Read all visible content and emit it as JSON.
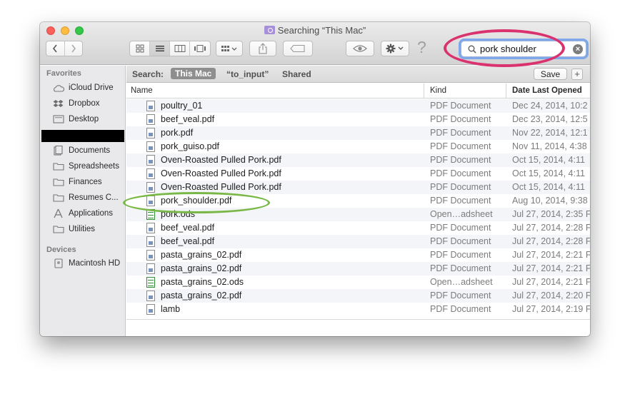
{
  "window": {
    "title": "Searching “This Mac”"
  },
  "toolbar": {
    "back_icon": "chevron-left-icon",
    "forward_icon": "chevron-right-icon",
    "help_glyph": "?",
    "search": {
      "value": "pork shoulder"
    }
  },
  "sidebar": {
    "favorites_header": "Favorites",
    "favorites": [
      {
        "label": "iCloud Drive",
        "icon": "cloud-icon"
      },
      {
        "label": "Dropbox",
        "icon": "dropbox-icon"
      },
      {
        "label": "Desktop",
        "icon": "desktop-icon"
      },
      {
        "label": "Documents",
        "icon": "documents-icon"
      },
      {
        "label": "Spreadsheets",
        "icon": "folder-icon"
      },
      {
        "label": "Finances",
        "icon": "folder-icon"
      },
      {
        "label": "Resumes C...",
        "icon": "folder-icon"
      },
      {
        "label": "Applications",
        "icon": "applications-icon"
      },
      {
        "label": "Utilities",
        "icon": "folder-icon"
      }
    ],
    "devices_header": "Devices",
    "devices": [
      {
        "label": "Macintosh HD",
        "icon": "hard-drive-icon"
      }
    ]
  },
  "scope": {
    "label": "Search:",
    "this_mac": "This Mac",
    "to_input": "“to_input”",
    "shared": "Shared",
    "save": "Save",
    "plus": "+"
  },
  "columns": {
    "name": "Name",
    "kind": "Kind",
    "date": "Date Last Opened"
  },
  "files": [
    {
      "name": "poultry_01",
      "kind": "PDF Document",
      "date": "Dec 24, 2014, 10:2",
      "type": "pdf"
    },
    {
      "name": "beef_veal.pdf",
      "kind": "PDF Document",
      "date": "Dec 23, 2014, 12:5",
      "type": "pdf"
    },
    {
      "name": "pork.pdf",
      "kind": "PDF Document",
      "date": "Nov 22, 2014, 12:1",
      "type": "pdf"
    },
    {
      "name": "pork_guiso.pdf",
      "kind": "PDF Document",
      "date": "Nov 11, 2014, 4:38",
      "type": "pdf"
    },
    {
      "name": "Oven-Roasted Pulled Pork.pdf",
      "kind": "PDF Document",
      "date": "Oct 15, 2014, 4:11",
      "type": "pdf"
    },
    {
      "name": "Oven-Roasted Pulled Pork.pdf",
      "kind": "PDF Document",
      "date": "Oct 15, 2014, 4:11",
      "type": "pdf"
    },
    {
      "name": "Oven-Roasted Pulled Pork.pdf",
      "kind": "PDF Document",
      "date": "Oct 15, 2014, 4:11",
      "type": "pdf"
    },
    {
      "name": "pork_shoulder.pdf",
      "kind": "PDF Document",
      "date": "Aug 10, 2014, 9:38",
      "type": "pdf"
    },
    {
      "name": "pork.ods",
      "kind": "Open…adsheet",
      "date": "Jul 27, 2014, 2:35 F",
      "type": "ods"
    },
    {
      "name": "beef_veal.pdf",
      "kind": "PDF Document",
      "date": "Jul 27, 2014, 2:28 F",
      "type": "pdf"
    },
    {
      "name": "beef_veal.pdf",
      "kind": "PDF Document",
      "date": "Jul 27, 2014, 2:28 F",
      "type": "pdf"
    },
    {
      "name": "pasta_grains_02.pdf",
      "kind": "PDF Document",
      "date": "Jul 27, 2014, 2:21 F",
      "type": "pdf"
    },
    {
      "name": "pasta_grains_02.pdf",
      "kind": "PDF Document",
      "date": "Jul 27, 2014, 2:21 F",
      "type": "pdf"
    },
    {
      "name": "pasta_grains_02.ods",
      "kind": "Open…adsheet",
      "date": "Jul 27, 2014, 2:21 F",
      "type": "ods"
    },
    {
      "name": "pasta_grains_02.pdf",
      "kind": "PDF Document",
      "date": "Jul 27, 2014, 2:20 F",
      "type": "pdf"
    },
    {
      "name": "lamb",
      "kind": "PDF Document",
      "date": "Jul 27, 2014, 2:19 F",
      "type": "pdf"
    }
  ],
  "annotations": {
    "search_highlight_color": "#d9326e",
    "result_highlight_color": "#79b846"
  }
}
